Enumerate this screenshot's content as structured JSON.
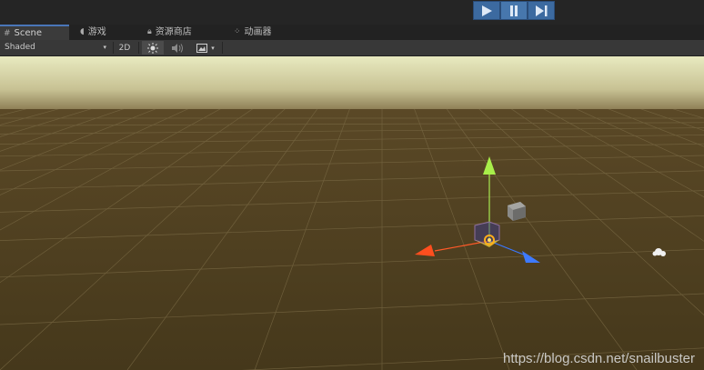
{
  "playbar": {
    "buttons": [
      {
        "name": "play",
        "icon": "play-icon"
      },
      {
        "name": "pause",
        "icon": "pause-icon"
      },
      {
        "name": "step",
        "icon": "step-icon"
      }
    ],
    "accent": "#3c6aa0"
  },
  "tabs": [
    {
      "label": "Scene",
      "icon": "grid-icon",
      "active": true
    },
    {
      "label": "游戏",
      "icon": "pacman-icon",
      "active": false
    },
    {
      "label": "资源商店",
      "icon": "lock-icon",
      "active": false
    },
    {
      "label": "动画器",
      "icon": "animator-icon",
      "active": false
    }
  ],
  "toolbar": {
    "shading_mode": "Shaded",
    "mode_2d": "2D",
    "lighting_icon": "sun-icon",
    "audio_icon": "speaker-icon",
    "effects_icon": "image-icon"
  },
  "scene": {
    "sky_color": "#e9ebc0",
    "ground_color": "#4a3a1c",
    "grid_color": "#6b5d3c"
  },
  "watermark": "https://blog.csdn.net/snailbuster"
}
